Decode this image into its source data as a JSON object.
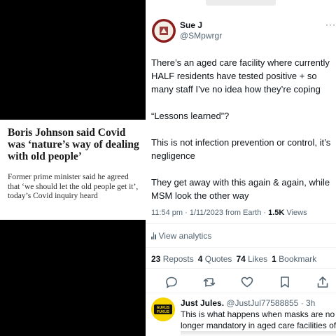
{
  "article": {
    "headline": "Boris Johnson said Covid was ‘nature’s way of dealing with old people’",
    "standfirst": "Former prime minister said he agreed that ‘we should let the old people get it’, today’s Covid inquiry heard"
  },
  "tweet": {
    "author_name": "Sue J",
    "author_handle": "@SMpwrgr",
    "more_label": "···",
    "body_lines": [
      "There’s an aged care facility where currently",
      "HALF residents have tested positive + so",
      "many staff I’ve no idea how they’re coping",
      "",
      "“Lessons learned”?",
      "",
      "This is not infection prevention or control, it’s",
      "negligence",
      "",
      "They get away with this again & again, while",
      "MSM look the other way"
    ],
    "timestamp": "11:54 pm · 1/11/2023 from Earth · ",
    "views_count": "1.5K",
    "views_label": " Views",
    "analytics_label": "View analytics",
    "reposts_count": "23",
    "reposts_label": " Reposts",
    "quotes_count": "4",
    "quotes_label": " Quotes",
    "likes_count": "74",
    "likes_label": " Likes",
    "bookmarks_count": "1",
    "bookmarks_label": " Bookmark",
    "actions": [
      "reply-icon",
      "repost-icon",
      "like-icon",
      "bookmark-icon",
      "share-icon"
    ]
  },
  "reply": {
    "author_name": "Just Jules.",
    "author_handle": " @JustJul77588855 · 3h",
    "more_label": "···",
    "avatar_text_top": "AUKUS",
    "avatar_text_bottom": "FUKUS",
    "body_lines": [
      "This is what happens when masks are no",
      "longer mandatory in aged care facilities of"
    ]
  },
  "colors": {
    "text_primary": "#0f1419",
    "text_secondary": "#536471",
    "avatar_bg": "#8b1d1d",
    "reply_avatar_bg": "#f5d400"
  }
}
